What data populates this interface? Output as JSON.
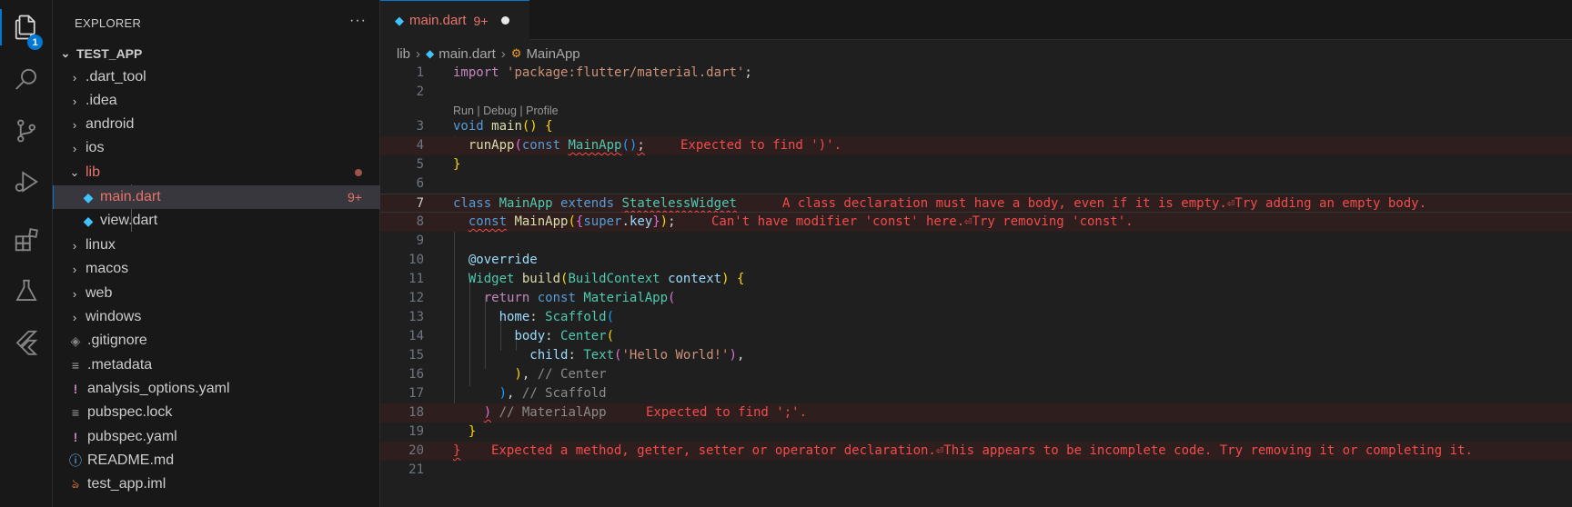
{
  "activity_bar": {
    "explorer_badge": "1",
    "items": [
      "files-icon",
      "search-icon",
      "source-control-icon",
      "run-debug-icon",
      "extensions-icon",
      "testing-icon",
      "flutter-icon"
    ]
  },
  "sidebar": {
    "title": "EXPLORER",
    "more": "···",
    "root": "TEST_APP",
    "items": [
      {
        "label": ".dart_tool",
        "type": "folder",
        "chevron": "›"
      },
      {
        "label": ".idea",
        "type": "folder",
        "chevron": "›"
      },
      {
        "label": "android",
        "type": "folder",
        "chevron": "›"
      },
      {
        "label": "ios",
        "type": "folder",
        "chevron": "›"
      },
      {
        "label": "lib",
        "type": "folder-open",
        "chevron": "⌄"
      },
      {
        "label": "main.dart",
        "type": "dart",
        "badge": "9+"
      },
      {
        "label": "view.dart",
        "type": "dart"
      },
      {
        "label": "linux",
        "type": "folder",
        "chevron": "›"
      },
      {
        "label": "macos",
        "type": "folder",
        "chevron": "›"
      },
      {
        "label": "web",
        "type": "folder",
        "chevron": "›"
      },
      {
        "label": "windows",
        "type": "folder",
        "chevron": "›"
      },
      {
        "label": ".gitignore",
        "type": "git"
      },
      {
        "label": ".metadata",
        "type": "text"
      },
      {
        "label": "analysis_options.yaml",
        "type": "yaml"
      },
      {
        "label": "pubspec.lock",
        "type": "text"
      },
      {
        "label": "pubspec.yaml",
        "type": "yaml"
      },
      {
        "label": "README.md",
        "type": "info"
      },
      {
        "label": "test_app.iml",
        "type": "rss"
      }
    ]
  },
  "editor": {
    "tab": {
      "name": "main.dart",
      "count": "9+"
    },
    "breadcrumb": [
      "lib",
      "main.dart",
      "MainApp"
    ],
    "codelens": "Run | Debug | Profile",
    "line_numbers": [
      "1",
      "2",
      "3",
      "4",
      "5",
      "6",
      "7",
      "8",
      "9",
      "10",
      "11",
      "12",
      "13",
      "14",
      "15",
      "16",
      "17",
      "18",
      "19",
      "20",
      "21"
    ],
    "diagnostics": {
      "line4": "Expected to find ')'.",
      "line7": "A class declaration must have a body, even if it is empty.⏎Try adding an empty body.",
      "line8": "Can't have modifier 'const' here.⏎Try removing 'const'.",
      "line18": "Expected to find ';'.",
      "line20": "Expected a method, getter, setter or operator declaration.⏎This appears to be incomplete code. Try removing it or completing it."
    }
  },
  "colors": {
    "accent": "#0078d4",
    "error": "#f14c4c",
    "modified": "#e8736b"
  }
}
